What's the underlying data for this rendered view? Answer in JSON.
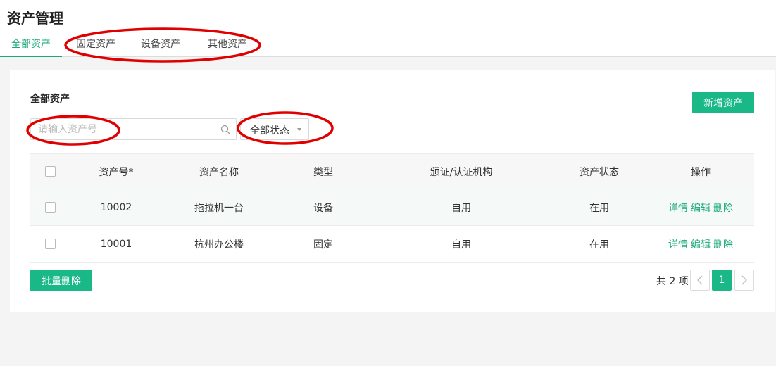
{
  "page": {
    "title": "资产管理"
  },
  "tabs": [
    {
      "label": "全部资产",
      "active": true
    },
    {
      "label": "固定资产",
      "active": false
    },
    {
      "label": "设备资产",
      "active": false
    },
    {
      "label": "其他资产",
      "active": false
    }
  ],
  "section": {
    "title": "全部资产"
  },
  "toolbar": {
    "add_label": "新增资产",
    "search_placeholder": "请输入资产号",
    "search_icon": "search-icon",
    "status_select_value": "全部状态"
  },
  "table": {
    "headers": [
      "资产号*",
      "资产名称",
      "类型",
      "颁证/认证机构",
      "资产状态",
      "操作"
    ],
    "rows": [
      {
        "id": "10002",
        "name": "拖拉机一台",
        "type": "设备",
        "issuer": "自用",
        "status": "在用"
      },
      {
        "id": "10001",
        "name": "杭州办公楼",
        "type": "固定",
        "issuer": "自用",
        "status": "在用"
      }
    ],
    "actions": {
      "detail": "详情",
      "edit": "编辑",
      "delete": "删除"
    }
  },
  "footer": {
    "batch_delete_label": "批量删除",
    "total_text": "共 2 项",
    "current_page": "1",
    "prev_icon": "chevron-left-icon",
    "next_icon": "chevron-right-icon"
  },
  "colors": {
    "accent": "#1ab887",
    "accent_text": "#1aa97b",
    "annotation": "#e00000"
  }
}
